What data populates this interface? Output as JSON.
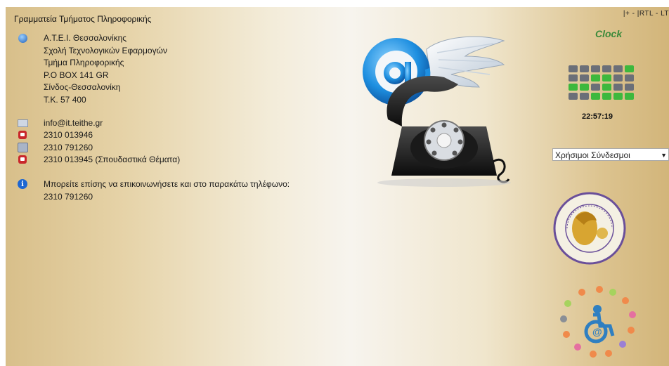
{
  "header": {
    "department_title": "Γραμματεία Τμήματος Πληροφορικής",
    "top_links": "|+ - |RTL - LT"
  },
  "address": {
    "icon": "globe-icon",
    "lines": [
      "A.T.E.I. Θεσσαλονίκης",
      "Σχολή Τεχνολογικών Εφαρμογών",
      "Τμήμα Πληροφορικής",
      "P.O BOX 141 GR",
      "Σίνδος-Θεσσαλονίκη",
      "T.K. 57 400"
    ]
  },
  "contacts": [
    {
      "icon": "mail-icon",
      "text": "info@it.teithe.gr"
    },
    {
      "icon": "phone-icon",
      "text": "2310 013946"
    },
    {
      "icon": "fax-icon",
      "text": "2310 791260"
    },
    {
      "icon": "phone-icon",
      "text": "2310 013945 (Σπουδαστικά Θέματα)"
    }
  ],
  "note": {
    "icon": "info-icon",
    "lines": [
      "Μπορείτε επίσης να επικοινωνήσετε και στο παρακάτω τηλέφωνο:",
      "2310 791260"
    ]
  },
  "clock": {
    "title": "Clock",
    "time": "22:57:19",
    "on_color": "#3db83d",
    "off_color": "#6b6f78"
  },
  "links_select": {
    "selected": "Χρήσιμοι Σύνδεσμοι"
  },
  "colors": {
    "accent_green": "#3a8a3a",
    "background_tan": "#d8bf8a"
  }
}
